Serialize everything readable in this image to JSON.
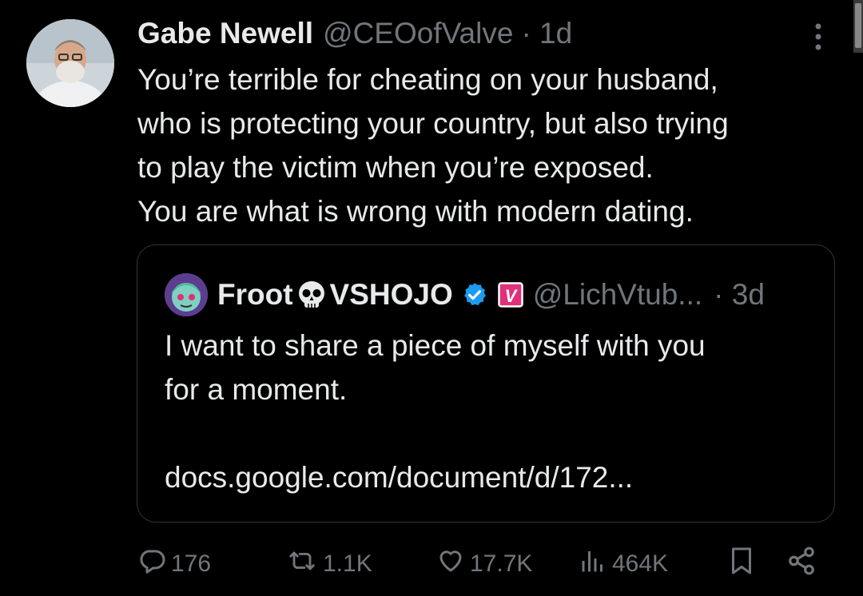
{
  "tweet": {
    "author_name": "Gabe Newell",
    "author_handle": "@CEOofValve",
    "time": "· 1d",
    "text_lines": [
      "You’re terrible for cheating on your husband,",
      "who is protecting your country, but also trying",
      "to play the victim when you’re exposed.",
      "You are what is wrong with modern dating."
    ]
  },
  "quote": {
    "name_part1": "Froot",
    "name_part2": "VSHOJO",
    "handle": "@LichVtub...",
    "time": "· 3d",
    "affiliate_label": "V",
    "text_lines": [
      "I want to share a piece of myself with you",
      "for a moment.",
      "",
      "docs.google.com/document/d/172..."
    ]
  },
  "actions": {
    "replies": "176",
    "reposts": "1.1K",
    "likes": "17.7K",
    "views": "464K"
  },
  "icons": [
    "more-icon",
    "verified-badge-icon",
    "affiliate-badge-icon",
    "reply-icon",
    "repost-icon",
    "like-icon",
    "views-icon",
    "bookmark-icon",
    "share-icon"
  ],
  "colors": {
    "background": "#000000",
    "text": "#e7e9ea",
    "secondary_text": "#71767b",
    "verified_blue": "#1d9bf0",
    "affiliate_pink": "#e0307a"
  }
}
